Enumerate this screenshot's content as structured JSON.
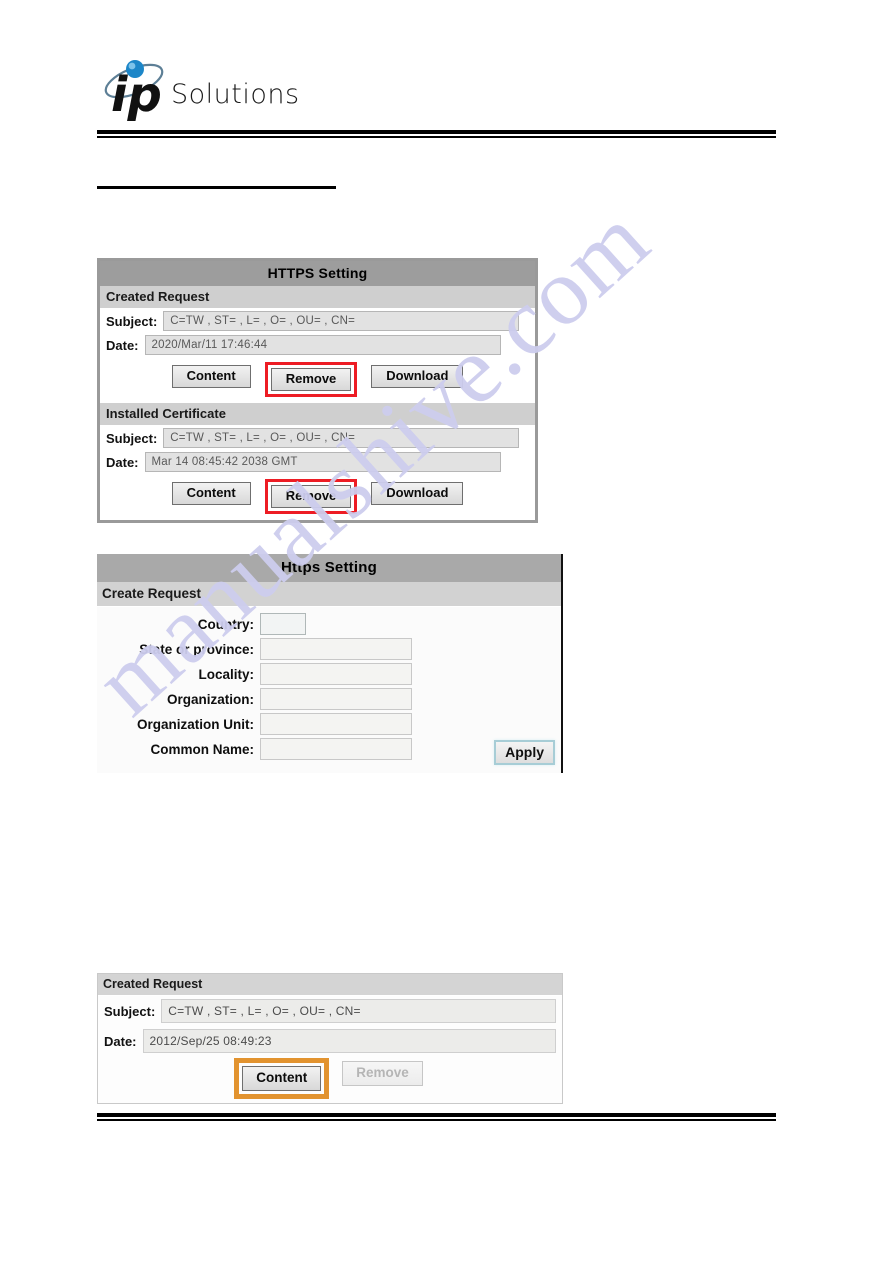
{
  "header": {
    "logo_mark": "ip-orbit-logo",
    "logo_word": "Solutions"
  },
  "watermark": {
    "text": "manualshive.com",
    "color": "#cdcdee"
  },
  "panel_https_setting": {
    "title": "HTTPS Setting",
    "sections": [
      {
        "heading": "Created Request",
        "fields": [
          {
            "label": "Subject:",
            "value": "C=TW , ST= , L= , O= , OU= , CN="
          },
          {
            "label": "Date:",
            "value": "2020/Mar/11 17:46:44"
          }
        ],
        "buttons": [
          {
            "label": "Content",
            "state": "normal",
            "highlight": "none"
          },
          {
            "label": "Remove",
            "state": "normal",
            "highlight": "red"
          },
          {
            "label": "Download",
            "state": "normal",
            "highlight": "none"
          }
        ]
      },
      {
        "heading": "Installed Certificate",
        "fields": [
          {
            "label": "Subject:",
            "value": "C=TW , ST= , L= , O= , OU= , CN="
          },
          {
            "label": "Date:",
            "value": "Mar 14 08:45:42 2038 GMT"
          }
        ],
        "buttons": [
          {
            "label": "Content",
            "state": "normal",
            "highlight": "none"
          },
          {
            "label": "Remove",
            "state": "normal",
            "highlight": "red"
          },
          {
            "label": "Download",
            "state": "normal",
            "highlight": "none"
          }
        ]
      }
    ]
  },
  "panel_create_request": {
    "title": "Https Setting",
    "heading": "Create Request",
    "fields": [
      {
        "label": "Country:",
        "value": "",
        "size": "small"
      },
      {
        "label": "State or province:",
        "value": "",
        "size": "wide"
      },
      {
        "label": "Locality:",
        "value": "",
        "size": "wide"
      },
      {
        "label": "Organization:",
        "value": "",
        "size": "wide"
      },
      {
        "label": "Organization Unit:",
        "value": "",
        "size": "wide"
      },
      {
        "label": "Common Name:",
        "value": "",
        "size": "wide"
      }
    ],
    "apply_label": "Apply"
  },
  "panel_created_request": {
    "heading": "Created Request",
    "fields": [
      {
        "label": "Subject:",
        "value": "C=TW , ST= , L= , O= , OU= , CN="
      },
      {
        "label": "Date:",
        "value": "2012/Sep/25 08:49:23"
      }
    ],
    "buttons": [
      {
        "label": "Content",
        "state": "normal",
        "highlight": "orange"
      },
      {
        "label": "Remove",
        "state": "disabled",
        "highlight": "none"
      }
    ]
  },
  "colors": {
    "highlight_red": "#ed1c24",
    "highlight_orange": "#e2932f",
    "panel_title_bg": "#9d9d9d",
    "panel_subhead_bg": "#cfcfcf",
    "logo_dot": "#1c86c8"
  }
}
